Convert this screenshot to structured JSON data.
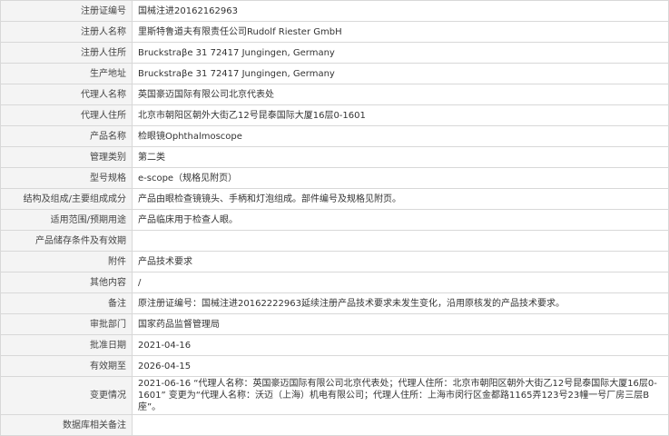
{
  "rows": [
    {
      "label": "注册证编号",
      "value": "国械注进20162162963"
    },
    {
      "label": "注册人名称",
      "value": "里斯特鲁道夫有限责任公司Rudolf Riester GmbH"
    },
    {
      "label": "注册人住所",
      "value": "Bruckstraβe 31 72417 Jungingen, Germany"
    },
    {
      "label": "生产地址",
      "value": "Bruckstraβe 31 72417 Jungingen, Germany"
    },
    {
      "label": "代理人名称",
      "value": "英国豪迈国际有限公司北京代表处"
    },
    {
      "label": "代理人住所",
      "value": "北京市朝阳区朝外大街乙12号昆泰国际大厦16层0-1601"
    },
    {
      "label": "产品名称",
      "value": "检眼镜Ophthalmoscope"
    },
    {
      "label": "管理类别",
      "value": "第二类"
    },
    {
      "label": "型号规格",
      "value": "e-scope（规格见附页）"
    },
    {
      "label": "结构及组成/主要组成成分",
      "value": "产品由眼检查镜镜头、手柄和灯泡组成。部件编号及规格见附页。"
    },
    {
      "label": "适用范围/预期用途",
      "value": "产品临床用于检查人眼。"
    },
    {
      "label": "产品储存条件及有效期",
      "value": ""
    },
    {
      "label": "附件",
      "value": "产品技术要求"
    },
    {
      "label": "其他内容",
      "value": "/"
    },
    {
      "label": "备注",
      "value": "原注册证编号：国械注进20162222963延续注册产品技术要求未发生变化，沿用原核发的产品技术要求。"
    },
    {
      "label": "审批部门",
      "value": "国家药品监督管理局"
    },
    {
      "label": "批准日期",
      "value": "2021-04-16"
    },
    {
      "label": "有效期至",
      "value": "2026-04-15"
    },
    {
      "label": "变更情况",
      "value": "2021-06-16 “代理人名称：英国豪迈国际有限公司北京代表处；代理人住所：北京市朝阳区朝外大街乙12号昆泰国际大厦16层0-1601” 变更为“代理人名称：沃迈（上海）机电有限公司；代理人住所：上海市闵行区金都路1165弄123号23幢一号厂房三层B座”。"
    },
    {
      "label": "数据库相关备注",
      "value": ""
    }
  ]
}
